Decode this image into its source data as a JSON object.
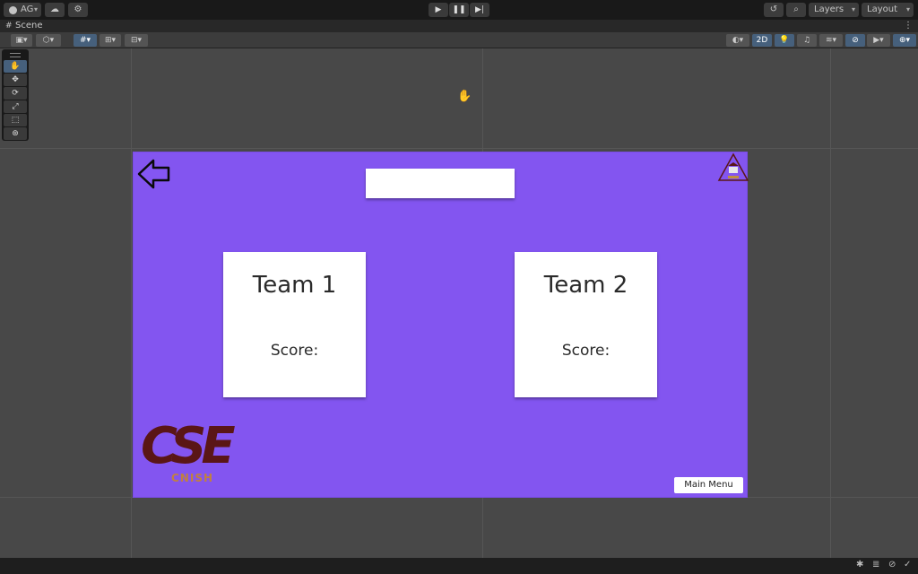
{
  "topbar": {
    "account_label": "AG",
    "layers_label": "Layers",
    "layout_label": "Layout"
  },
  "tabbar": {
    "scene_tab": "Scene"
  },
  "toolbar": {
    "view2d_label": "2D"
  },
  "game": {
    "team1": {
      "title": "Team 1",
      "score_label": "Score:"
    },
    "team2": {
      "title": "Team 2",
      "score_label": "Score:"
    },
    "main_menu_label": "Main Menu",
    "logo": {
      "text": "CSE",
      "subtext": "CNISH",
      "color": "#5a1616"
    },
    "background_color": "#8355f0"
  }
}
